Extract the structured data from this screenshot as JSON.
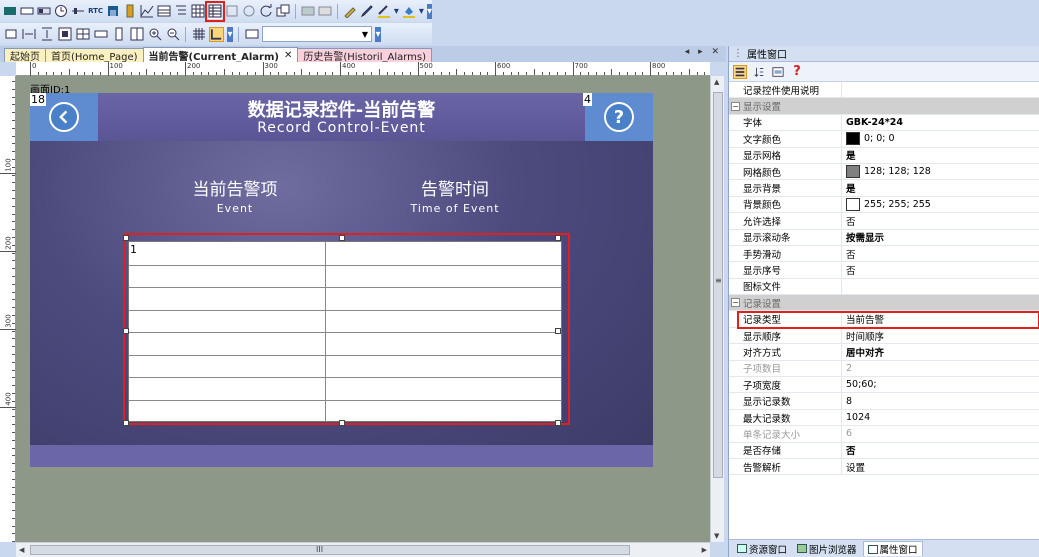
{
  "toolbar1": {
    "rtc_label": "RTC"
  },
  "tabs": [
    {
      "label": "起始页",
      "active": false,
      "style": "normal"
    },
    {
      "label": "首页(Home_Page)",
      "active": false,
      "style": "normal"
    },
    {
      "label": "当前告警(Current_Alarm)",
      "active": true,
      "style": "normal"
    },
    {
      "label": "历史告警(Historil_Alarms)",
      "active": false,
      "style": "pink"
    }
  ],
  "tab_scroll": "◂ ▸ ✕",
  "ruler": {
    "top": [
      "0",
      "100",
      "200",
      "300",
      "400",
      "500",
      "600",
      "700",
      "800"
    ],
    "left": [
      "100",
      "200",
      "300",
      "400"
    ]
  },
  "canvas": {
    "screen_label": "画面ID:1",
    "left_id": "18",
    "right_id": "4",
    "title": "数据记录控件-当前告警",
    "subtitle": "Record Control-Event",
    "col1_cn": "当前告警项",
    "col1_en": "Event",
    "col2_cn": "告警时间",
    "col2_en": "Time of Event",
    "table_id": "1",
    "back_icon": "back-arrow-icon",
    "help_icon": "help-icon",
    "help_text": "?"
  },
  "hscroll_label": "III",
  "panel": {
    "title": "属性窗口",
    "rows": [
      {
        "type": "row",
        "key": "记录控件使用说明",
        "value": ""
      },
      {
        "type": "cat",
        "key": "显示设置"
      },
      {
        "type": "row",
        "key": "字体",
        "value": "GBK-24*24",
        "bold": true
      },
      {
        "type": "row",
        "key": "文字颜色",
        "value": "0; 0; 0",
        "swatch": "#000000"
      },
      {
        "type": "row",
        "key": "显示网格",
        "value": "是",
        "bold": true
      },
      {
        "type": "row",
        "key": "网格颜色",
        "value": "128; 128; 128",
        "swatch": "#808080"
      },
      {
        "type": "row",
        "key": "显示背景",
        "value": "是",
        "bold": true
      },
      {
        "type": "row",
        "key": "背景颜色",
        "value": "255; 255; 255",
        "swatch": "#ffffff"
      },
      {
        "type": "row",
        "key": "允许选择",
        "value": "否"
      },
      {
        "type": "row",
        "key": "显示滚动条",
        "value": "按需显示",
        "bold": true
      },
      {
        "type": "row",
        "key": "手势滑动",
        "value": "否"
      },
      {
        "type": "row",
        "key": "显示序号",
        "value": "否"
      },
      {
        "type": "row",
        "key": "图标文件",
        "value": ""
      },
      {
        "type": "cat",
        "key": "记录设置"
      },
      {
        "type": "row",
        "key": "记录类型",
        "value": "当前告警",
        "highlight": true
      },
      {
        "type": "row",
        "key": "显示顺序",
        "value": "时间顺序"
      },
      {
        "type": "row",
        "key": "对齐方式",
        "value": "居中对齐",
        "bold": true
      },
      {
        "type": "row",
        "key": "子项数目",
        "value": "2",
        "grey": true
      },
      {
        "type": "row",
        "key": "子项宽度",
        "value": "50;60;"
      },
      {
        "type": "row",
        "key": "显示记录数",
        "value": "8"
      },
      {
        "type": "row",
        "key": "最大记录数",
        "value": "1024"
      },
      {
        "type": "row",
        "key": "单条记录大小",
        "value": "6",
        "grey": true
      },
      {
        "type": "row",
        "key": "是否存储",
        "value": "否",
        "bold": true
      },
      {
        "type": "row",
        "key": "告警解析",
        "value": "设置"
      }
    ],
    "bottom_tabs": [
      {
        "label": "资源窗口",
        "active": false
      },
      {
        "label": "图片浏览器",
        "active": false
      },
      {
        "label": "属性窗口",
        "active": true
      }
    ]
  },
  "colors": {
    "highlight": "#e02020",
    "hmi_bg": "#4d4b7e",
    "hmi_button": "#5f8bd0"
  }
}
